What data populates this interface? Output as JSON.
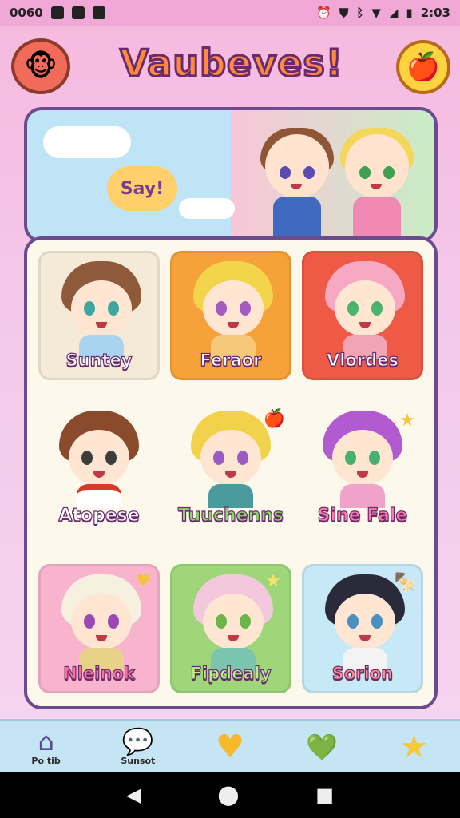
{
  "status_bar": {
    "left_text": "0060",
    "time": "2:03"
  },
  "header": {
    "title": "Vaubeves!",
    "logo_icon": "monkey-face-icon",
    "fav_icon": "apple-icon"
  },
  "banner": {
    "bubble_text": "Say!"
  },
  "characters": [
    {
      "name": "Suntey",
      "bg": "#f5ead8",
      "hair": "#8e5a3a",
      "eyes": "#3fa6a0",
      "body": "#a9d4ef"
    },
    {
      "name": "Feraor",
      "bg": "#f6a13a",
      "hair": "#f2d54a",
      "eyes": "#a45bc0",
      "body": "#f6c87a"
    },
    {
      "name": "Vlordes",
      "bg": "#ef5a46",
      "hair": "#f7a8c2",
      "eyes": "#4bb36d",
      "body": "#f3a4b4"
    },
    {
      "name": "Atopese",
      "bg": "#fdf8ec",
      "hair": "#8a4a2c",
      "eyes": "#3d3d3d",
      "body": "#ffffff"
    },
    {
      "name": "Tuuchenns",
      "bg": "#fdf8ec",
      "hair": "#f1d24a",
      "eyes": "#9c5bc4",
      "body": "#4b9a9e"
    },
    {
      "name": "Sine Fale",
      "bg": "#fdf8ec",
      "hair": "#b25ad0",
      "eyes": "#48b070",
      "body": "#f0a3c8"
    },
    {
      "name": "Nleinok",
      "bg": "#f8b4cc",
      "hair": "#f5f0e0",
      "eyes": "#9a48b4",
      "body": "#e8d28a"
    },
    {
      "name": "Fipdealy",
      "bg": "#9fd67a",
      "hair": "#f3c8dc",
      "eyes": "#6ab64a",
      "body": "#7ac4b0"
    },
    {
      "name": "Sorion",
      "bg": "#c7e8f6",
      "hair": "#2a2a3a",
      "eyes": "#4a8fc0",
      "body": "#f3f3f3"
    }
  ],
  "bottom_nav": [
    {
      "icon": "home-icon",
      "glyph": "⌂",
      "label": "Po tib"
    },
    {
      "icon": "chat-bubbles-icon",
      "glyph": "💬",
      "label": "Sunsot"
    },
    {
      "icon": "heart-icon",
      "glyph": "♥",
      "label": ""
    },
    {
      "icon": "gift-heart-icon",
      "glyph": "💚",
      "label": ""
    },
    {
      "icon": "star-icon",
      "glyph": "★",
      "label": ""
    }
  ],
  "system_nav": {
    "back": "◀",
    "home": "⬤",
    "recents": "■"
  },
  "colors": {
    "accent": "#6b4a8e",
    "background": "#f6b9de"
  }
}
